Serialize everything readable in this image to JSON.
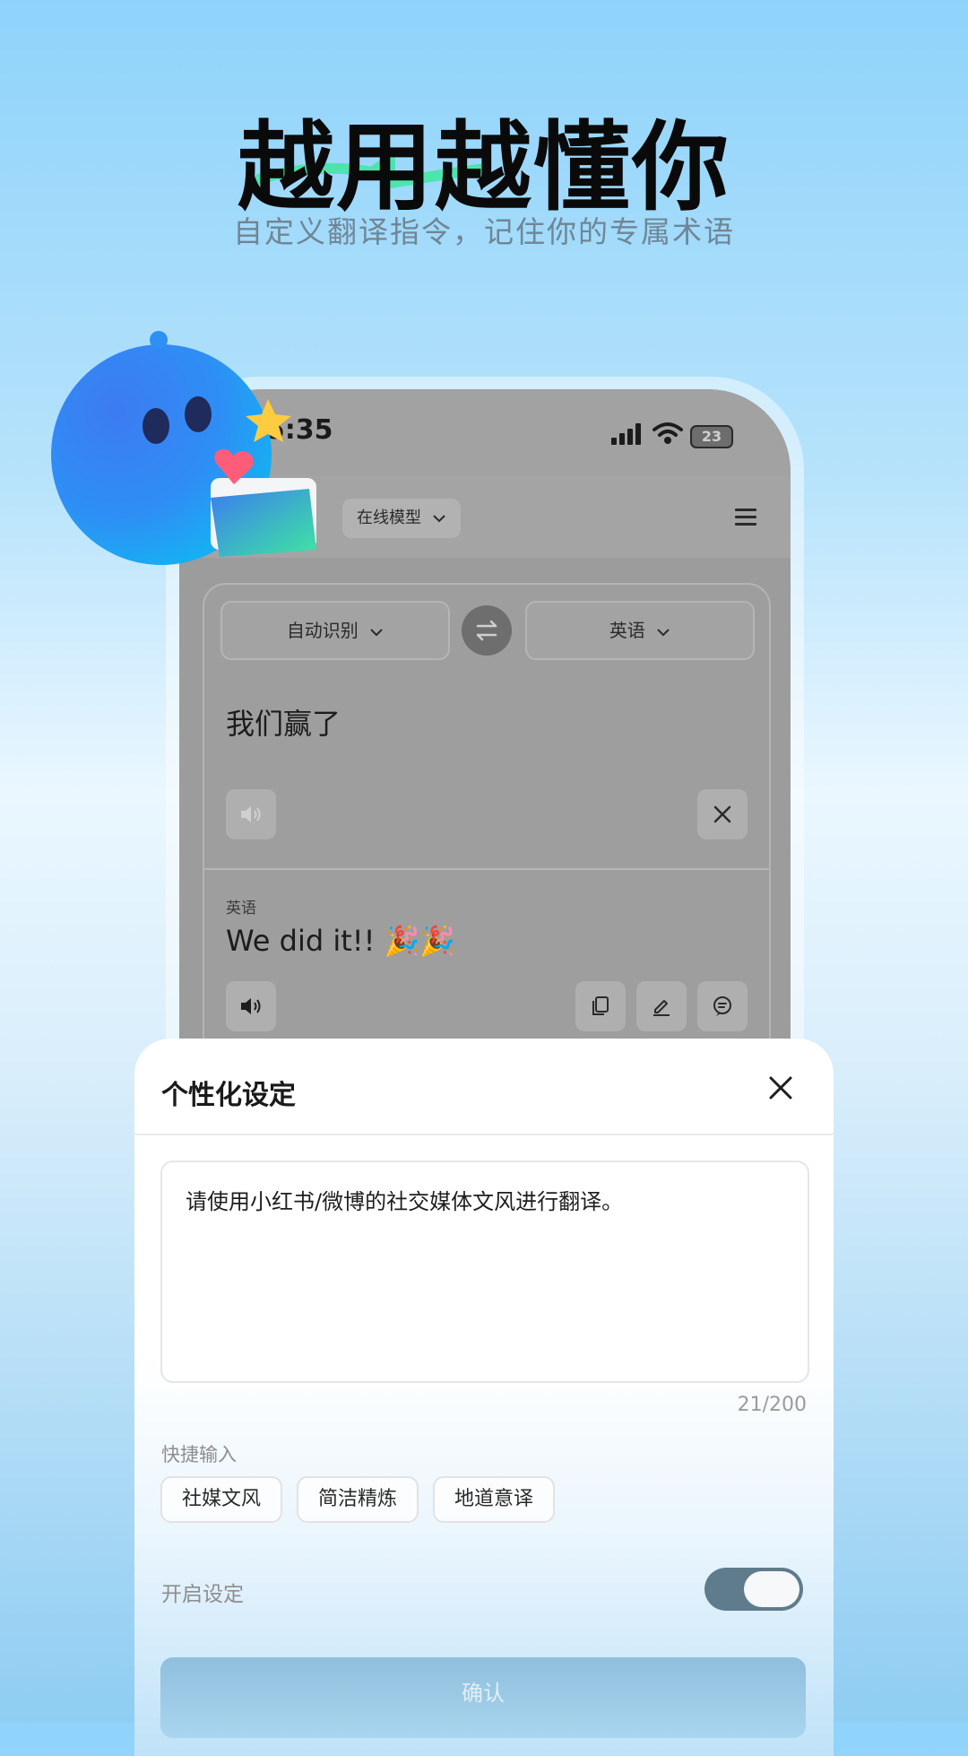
{
  "hero": {
    "title": "越用越懂你",
    "subtitle": "自定义翻译指令，记住你的专属术语"
  },
  "phone": {
    "status": {
      "time": "15:35",
      "battery": "23"
    },
    "app_bar": {
      "model_select": "在线模型"
    },
    "translator": {
      "source_lang": "自动识别",
      "target_lang": "英语",
      "source_text": "我们赢了",
      "target_label": "英语",
      "target_text": "We did it!! 🎉🎉"
    }
  },
  "sheet": {
    "title": "个性化设定",
    "instruction_text": "请使用小红书/微博的社交媒体文风进行翻译。",
    "counter": "21/200",
    "quick_label": "快捷输入",
    "chips": [
      "社媒文风",
      "简洁精炼",
      "地道意译"
    ],
    "enable_label": "开启设定",
    "enable_on": true,
    "confirm_label": "确认"
  },
  "colors": {
    "accent_green": "#3ee6a0",
    "mascot_blue": "#2d8cf5",
    "toggle_on": "#5f7c8c"
  }
}
